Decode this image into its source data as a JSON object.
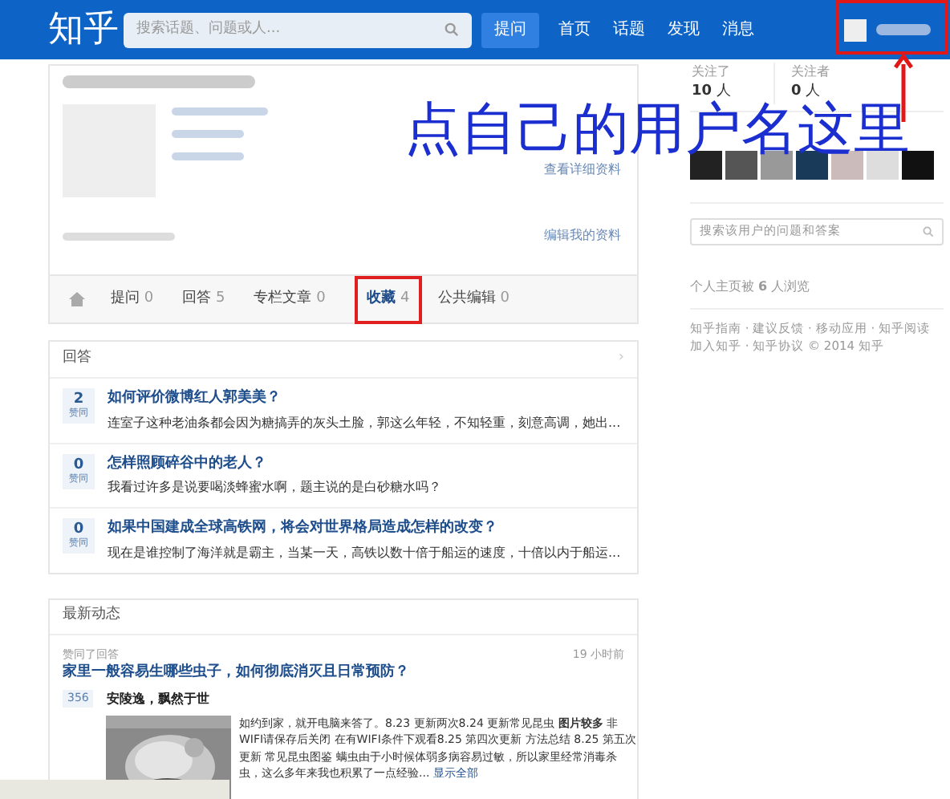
{
  "header": {
    "logo": "知乎",
    "search": {
      "placeholder": "搜索话题、问题或人..."
    },
    "ask_button": "提问",
    "nav": [
      {
        "label": "首页"
      },
      {
        "label": "话题"
      },
      {
        "label": "发现"
      },
      {
        "label": "消息"
      }
    ]
  },
  "profile": {
    "detail_link": "查看详细资料",
    "edit_link": "编辑我的资料",
    "tabs": [
      {
        "label": "提问",
        "count": "0",
        "selected": false
      },
      {
        "label": "回答",
        "count": "5",
        "selected": false
      },
      {
        "label": "专栏文章",
        "count": "0",
        "selected": false
      },
      {
        "label": "收藏",
        "count": "4",
        "selected": true
      },
      {
        "label": "公共编辑",
        "count": "0",
        "selected": false
      }
    ]
  },
  "answers": {
    "title": "回答",
    "more_icon": "›",
    "items": [
      {
        "votes": "2",
        "vote_label": "赞同",
        "title": "如何评价微博红人郭美美？",
        "excerpt": "连室子这种老油条都会因为糖搞弄的灰头土脸，郭这么年轻，不知轻重，刻意高调，她出..."
      },
      {
        "votes": "0",
        "vote_label": "赞同",
        "title": "怎样照顾碎谷中的老人？",
        "excerpt": "我看过许多是说要喝淡蜂蜜水啊，题主说的是白砂糖水吗？"
      },
      {
        "votes": "0",
        "vote_label": "赞同",
        "title": "如果中国建成全球高铁网，将会对世界格局造成怎样的改变？",
        "excerpt": "现在是谁控制了海洋就是霸主，当某一天，高铁以数十倍于船运的速度，十倍以内于船运..."
      }
    ]
  },
  "activity": {
    "title": "最新动态",
    "item": {
      "action": "赞同了回答",
      "time": "19 小时前",
      "question": "家里一般容易生哪些虫子，如何彻底消灭且日常预防？",
      "votes": "356",
      "author": "安陵逸，飘然于世",
      "excerpt": "如约到家，就开电脑来答了。8.23 更新两次8.24 更新常见昆虫 **图片较多** 非WIFI请保存后关闭 在有WIFI条件下观看8.25 第四次更新 方法总结 8.25 第五次更新 常见昆虫图鉴 螨虫由于小时候体弱多病容易过敏，所以家里经常消毒杀虫，这么多年来我也积累了一点经验...",
      "more": "显示全部"
    }
  },
  "sidebar": {
    "stats": [
      {
        "label": "关注了",
        "value": "10",
        "unit": "人"
      },
      {
        "label": "关注者",
        "value": "0",
        "unit": "人"
      }
    ],
    "search": {
      "placeholder": "搜索该用户的问题和答案"
    },
    "views": "个人主页被 **6** 人浏览",
    "footer": [
      "知乎指南 · 建议反馈 · 移动应用 · 知乎阅读",
      "加入知乎 · 知乎协议 © 2014 知乎"
    ]
  },
  "annotation": {
    "text": "点自己的用户名这里"
  }
}
